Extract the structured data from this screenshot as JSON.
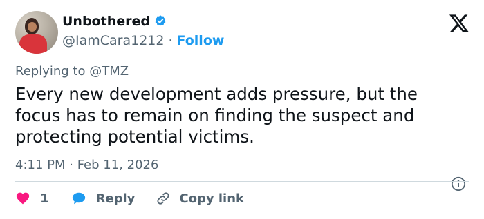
{
  "user": {
    "display_name": "Unbothered",
    "handle": "@IamCara1212",
    "separator": "·",
    "follow_label": "Follow",
    "verified_color": "#1d9bf0"
  },
  "reply": {
    "prefix": "Replying to ",
    "mention": "@TMZ"
  },
  "tweet": {
    "text": "Every new development adds pressure, but the focus has to remain on finding the suspect and protecting potential victims.",
    "timestamp": "4:11 PM · Feb 11, 2026"
  },
  "actions": {
    "like_count": "1",
    "reply_label": "Reply",
    "copy_label": "Copy link",
    "like_color": "#f91880",
    "reply_color": "#1d9bf0"
  },
  "icons": {
    "brand": "x-logo-icon",
    "verified": "verified-badge-icon",
    "info": "info-icon",
    "like": "heart-icon",
    "reply": "speech-bubble-icon",
    "copy": "link-icon"
  }
}
